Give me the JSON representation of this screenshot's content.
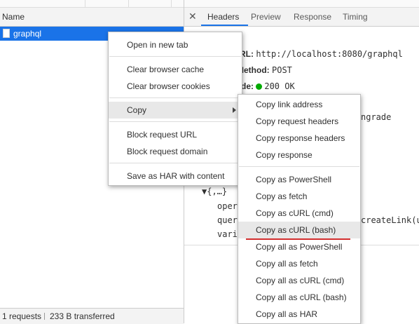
{
  "network_list": {
    "header": "Name",
    "request_name": "graphql",
    "status": {
      "requests": "1 requests",
      "transferred": "233 B transferred"
    }
  },
  "detail_tabs": {
    "close_glyph": "✕",
    "tabs": [
      "Headers",
      "Preview",
      "Response",
      "Timing"
    ],
    "active": "Headers"
  },
  "headers": {
    "request_url_key": "RL:",
    "request_url": "http://localhost:8080/graphql",
    "method_key": "Method:",
    "method": "POST",
    "status_key": "de:",
    "status": "200 OK",
    "status_color": "#00aa00",
    "partial_text": "ngrade"
  },
  "payload": {
    "root": "▼{,…}",
    "key1": "opera",
    "key2": "quer",
    "key3": "vari",
    "query_partial": "createLink(ur"
  },
  "context_menu": {
    "items": [
      "Open in new tab",
      "Clear browser cache",
      "Clear browser cookies",
      "Copy",
      "Block request URL",
      "Block request domain",
      "Save as HAR with content"
    ],
    "highlighted": "Copy"
  },
  "copy_submenu": {
    "items": [
      "Copy link address",
      "Copy request headers",
      "Copy response headers",
      "Copy response",
      "Copy as PowerShell",
      "Copy as fetch",
      "Copy as cURL (cmd)",
      "Copy as cURL (bash)",
      "Copy all as PowerShell",
      "Copy all as fetch",
      "Copy all as cURL (cmd)",
      "Copy all as cURL (bash)",
      "Copy all as HAR"
    ],
    "highlighted": "Copy as cURL (bash)",
    "annotation_color": "#d32f2f"
  },
  "colors": {
    "selected_row": "#1a73e8",
    "tab_accent": "#1a73e8"
  }
}
